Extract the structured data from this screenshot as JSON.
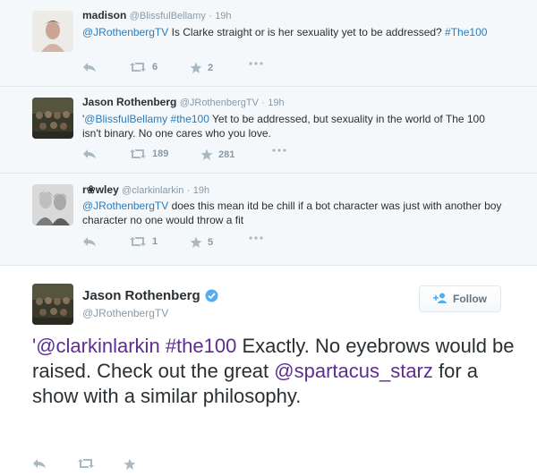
{
  "replies": [
    {
      "name": "madison",
      "handle": "@BlissfulBellamy",
      "sep": "·",
      "time": "19h",
      "text_parts": [
        "@JRothenbergTV",
        " Is Clarke straight or is her sexuality yet to be addressed? ",
        "#The100"
      ],
      "retweets": "6",
      "favorites": "2"
    },
    {
      "name": "Jason Rothenberg",
      "handle": "@JRothenbergTV",
      "sep": "·",
      "time": "19h",
      "text_parts": [
        "'",
        "@BlissfulBellamy",
        " ",
        "#the100",
        " Yet to be addressed, but sexuality in the world of The 100 isn't binary. No one cares who you love."
      ],
      "retweets": "189",
      "favorites": "281"
    },
    {
      "name": "r❀wley",
      "handle": "@clarkinlarkin",
      "sep": "·",
      "time": "19h",
      "text_parts": [
        "@JRothenbergTV",
        " does this mean itd be chill if a bot character was just with another boy character no one would throw a fit"
      ],
      "retweets": "1",
      "favorites": "5"
    }
  ],
  "main": {
    "name": "Jason Rothenberg",
    "handle": "@JRothenbergTV",
    "follow_label": "Follow",
    "text_parts": [
      "'",
      "@clarkinlarkin",
      " ",
      "#the100",
      " Exactly. No eyebrows would be raised. Check out the great ",
      "@spartacus_starz",
      " for a show with a similar philosophy."
    ]
  },
  "icons": {
    "reply": "reply-icon",
    "retweet": "retweet-icon",
    "favorite": "star-icon",
    "more": "more-icon",
    "verified": "verified-badge-icon",
    "follow": "add-user-icon"
  },
  "colors": {
    "link": "#2b7bb9",
    "main_link": "#5f2d92",
    "verified": "#55acee"
  }
}
